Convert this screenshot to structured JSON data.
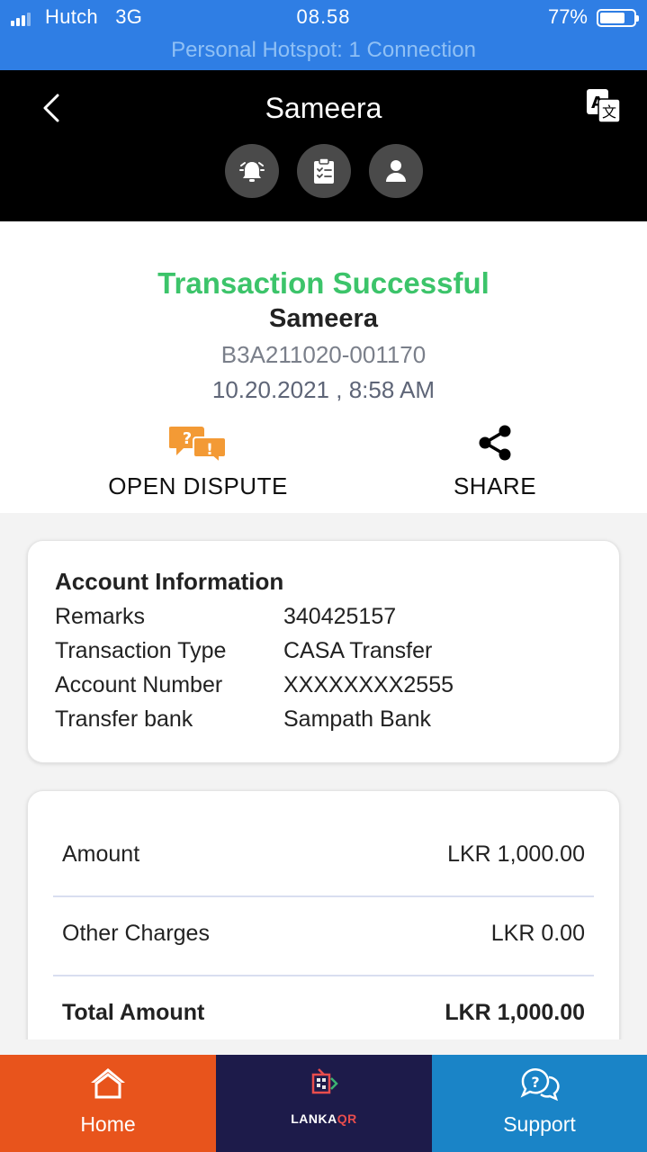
{
  "status_bar": {
    "carrier": "Hutch",
    "network": "3G",
    "time": "08.58",
    "battery": "77%",
    "battery_level": 0.77,
    "hotspot": "Personal Hotspot: 1 Connection"
  },
  "header": {
    "title": "Sameera",
    "icons": [
      "back-chevron-icon",
      "translate-icon",
      "alarm-bell-icon",
      "clipboard-checklist-icon",
      "user-profile-icon"
    ]
  },
  "transaction": {
    "status": "Transaction Successful",
    "name": "Sameera",
    "reference": "B3A211020-001170",
    "datetime": "10.20.2021 , 8:58 AM",
    "status_color": "#3cc46a"
  },
  "actions": {
    "dispute_label": "OPEN DISPUTE",
    "share_label": "SHARE"
  },
  "account_info": {
    "title": "Account Information",
    "rows": [
      {
        "label": "Remarks",
        "value": "340425157"
      },
      {
        "label": "Transaction Type",
        "value": "CASA Transfer"
      },
      {
        "label": "Account Number",
        "value": "XXXXXXXX2555"
      },
      {
        "label": "Transfer bank",
        "value": "Sampath Bank"
      }
    ]
  },
  "amounts": {
    "rows": [
      {
        "label": "Amount",
        "value": "LKR 1,000.00"
      },
      {
        "label": "Other Charges",
        "value": "LKR 0.00"
      },
      {
        "label": "Total Amount",
        "value": "LKR 1,000.00"
      }
    ]
  },
  "bottom_nav": {
    "home_label": "Home",
    "lanka_text": "LANKA",
    "lanka_qr": "QR",
    "support_label": "Support",
    "colors": {
      "home": "#e8541c",
      "lankaqr": "#1d1b4a",
      "support": "#1a84c7"
    }
  }
}
